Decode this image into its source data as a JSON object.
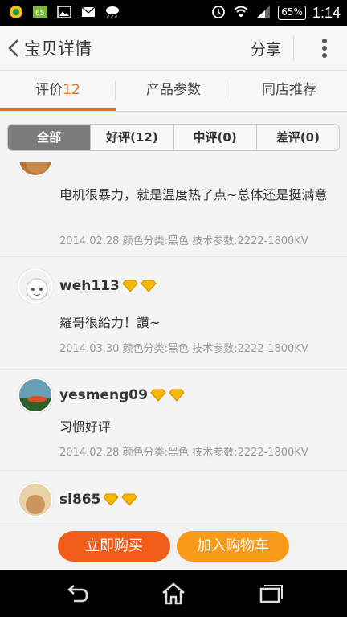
{
  "status": {
    "time": "1:14",
    "battery": "65%"
  },
  "header": {
    "title": "宝贝详情",
    "share": "分享"
  },
  "tabs": [
    {
      "label": "评价",
      "count": "12"
    },
    {
      "label": "产品参数",
      "count": ""
    },
    {
      "label": "同店推荐",
      "count": ""
    }
  ],
  "filter": [
    "全部",
    "好评(12)",
    "中评(0)",
    "差评(0)"
  ],
  "reviews": [
    {
      "name": "",
      "text": "电机很暴力，就是温度热了点~总体还是挺满意",
      "meta": "2014.02.28 颜色分类:黑色  技术参数:2222-1800KV"
    },
    {
      "name": "weh113",
      "text": "羅哥很給力！讚~",
      "meta": "2014.03.30 颜色分类:黑色  技术参数:2222-1800KV"
    },
    {
      "name": "yesmeng09",
      "text": "习惯好评",
      "meta": "2014.02.28 颜色分类:黑色  技术参数:2222-1800KV"
    },
    {
      "name": "sl865",
      "text": "",
      "meta": ""
    }
  ],
  "actions": {
    "buy": "立即购买",
    "cart": "加入购物车"
  },
  "colors": {
    "accent": "#f06a1e",
    "buy": "#f25c19",
    "cart": "#f89a1c"
  }
}
